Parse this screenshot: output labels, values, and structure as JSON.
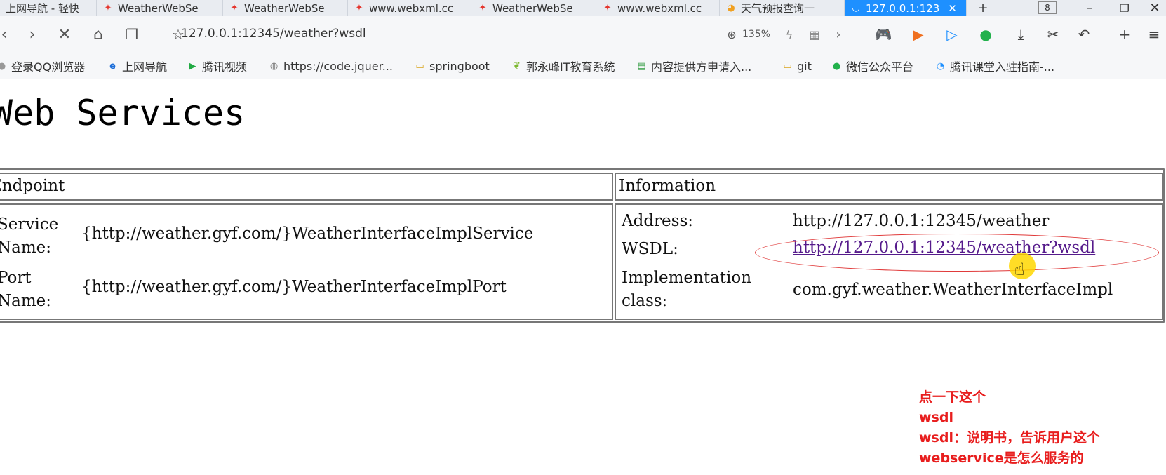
{
  "browser": {
    "tabs": [
      {
        "label": "上网导航 - 轻快",
        "icon": "ie-icon"
      },
      {
        "label": "WeatherWebSe",
        "icon": "webxml-icon"
      },
      {
        "label": "WeatherWebSe",
        "icon": "webxml-icon"
      },
      {
        "label": "www.webxml.cc",
        "icon": "webxml-icon"
      },
      {
        "label": "WeatherWebSe",
        "icon": "webxml-icon"
      },
      {
        "label": "www.webxml.cc",
        "icon": "webxml-icon"
      },
      {
        "label": "天气预报查询一",
        "icon": "weather-icon"
      },
      {
        "label": "127.0.0.1:123",
        "icon": "loading-icon",
        "active": true
      }
    ],
    "new_tab": "+",
    "tab_count": "8",
    "address": "127.0.0.1:12345/weather?wsdl",
    "zoom": "135%",
    "accent_color": "#1e90ff"
  },
  "bookmarks": [
    {
      "label": "登录QQ浏览器",
      "icon": "qq-icon"
    },
    {
      "label": "上网导航",
      "icon": "ie-icon"
    },
    {
      "label": "腾讯视频",
      "icon": "video-icon"
    },
    {
      "label": "https://code.jquer...",
      "icon": "globe-icon"
    },
    {
      "label": "springboot",
      "icon": "folder-icon"
    },
    {
      "label": "郭永峰IT教育系统",
      "icon": "leaf-icon"
    },
    {
      "label": "内容提供方申请入...",
      "icon": "doc-icon"
    },
    {
      "label": "git",
      "icon": "folder-icon"
    },
    {
      "label": "微信公众平台",
      "icon": "wechat-icon"
    },
    {
      "label": "腾讯课堂入驻指南-...",
      "icon": "tencent-class-icon"
    }
  ],
  "page": {
    "title": "Web Services",
    "headers": {
      "endpoint": "Endpoint",
      "information": "Information"
    },
    "endpoint": {
      "service_label": "Service Name:",
      "service_value": "{http://weather.gyf.com/}WeatherInterfaceImplService",
      "port_label": "Port Name:",
      "port_value": "{http://weather.gyf.com/}WeatherInterfaceImplPort"
    },
    "information": {
      "address_label": "Address:",
      "address_value": "http://127.0.0.1:12345/weather",
      "wsdl_label": "WSDL:",
      "wsdl_value": "http://127.0.0.1:12345/weather?wsdl",
      "impl_label_1": "Implementation",
      "impl_label_2": "class:",
      "impl_value": "com.gyf.weather.WeatherInterfaceImpl"
    }
  },
  "annotation": {
    "line1": "点一下这个",
    "line2": "wsdl",
    "line3": "wsdl：说明书，告诉用户这个",
    "line4": "webservice是怎么服务的",
    "color": "#e81e1e"
  }
}
